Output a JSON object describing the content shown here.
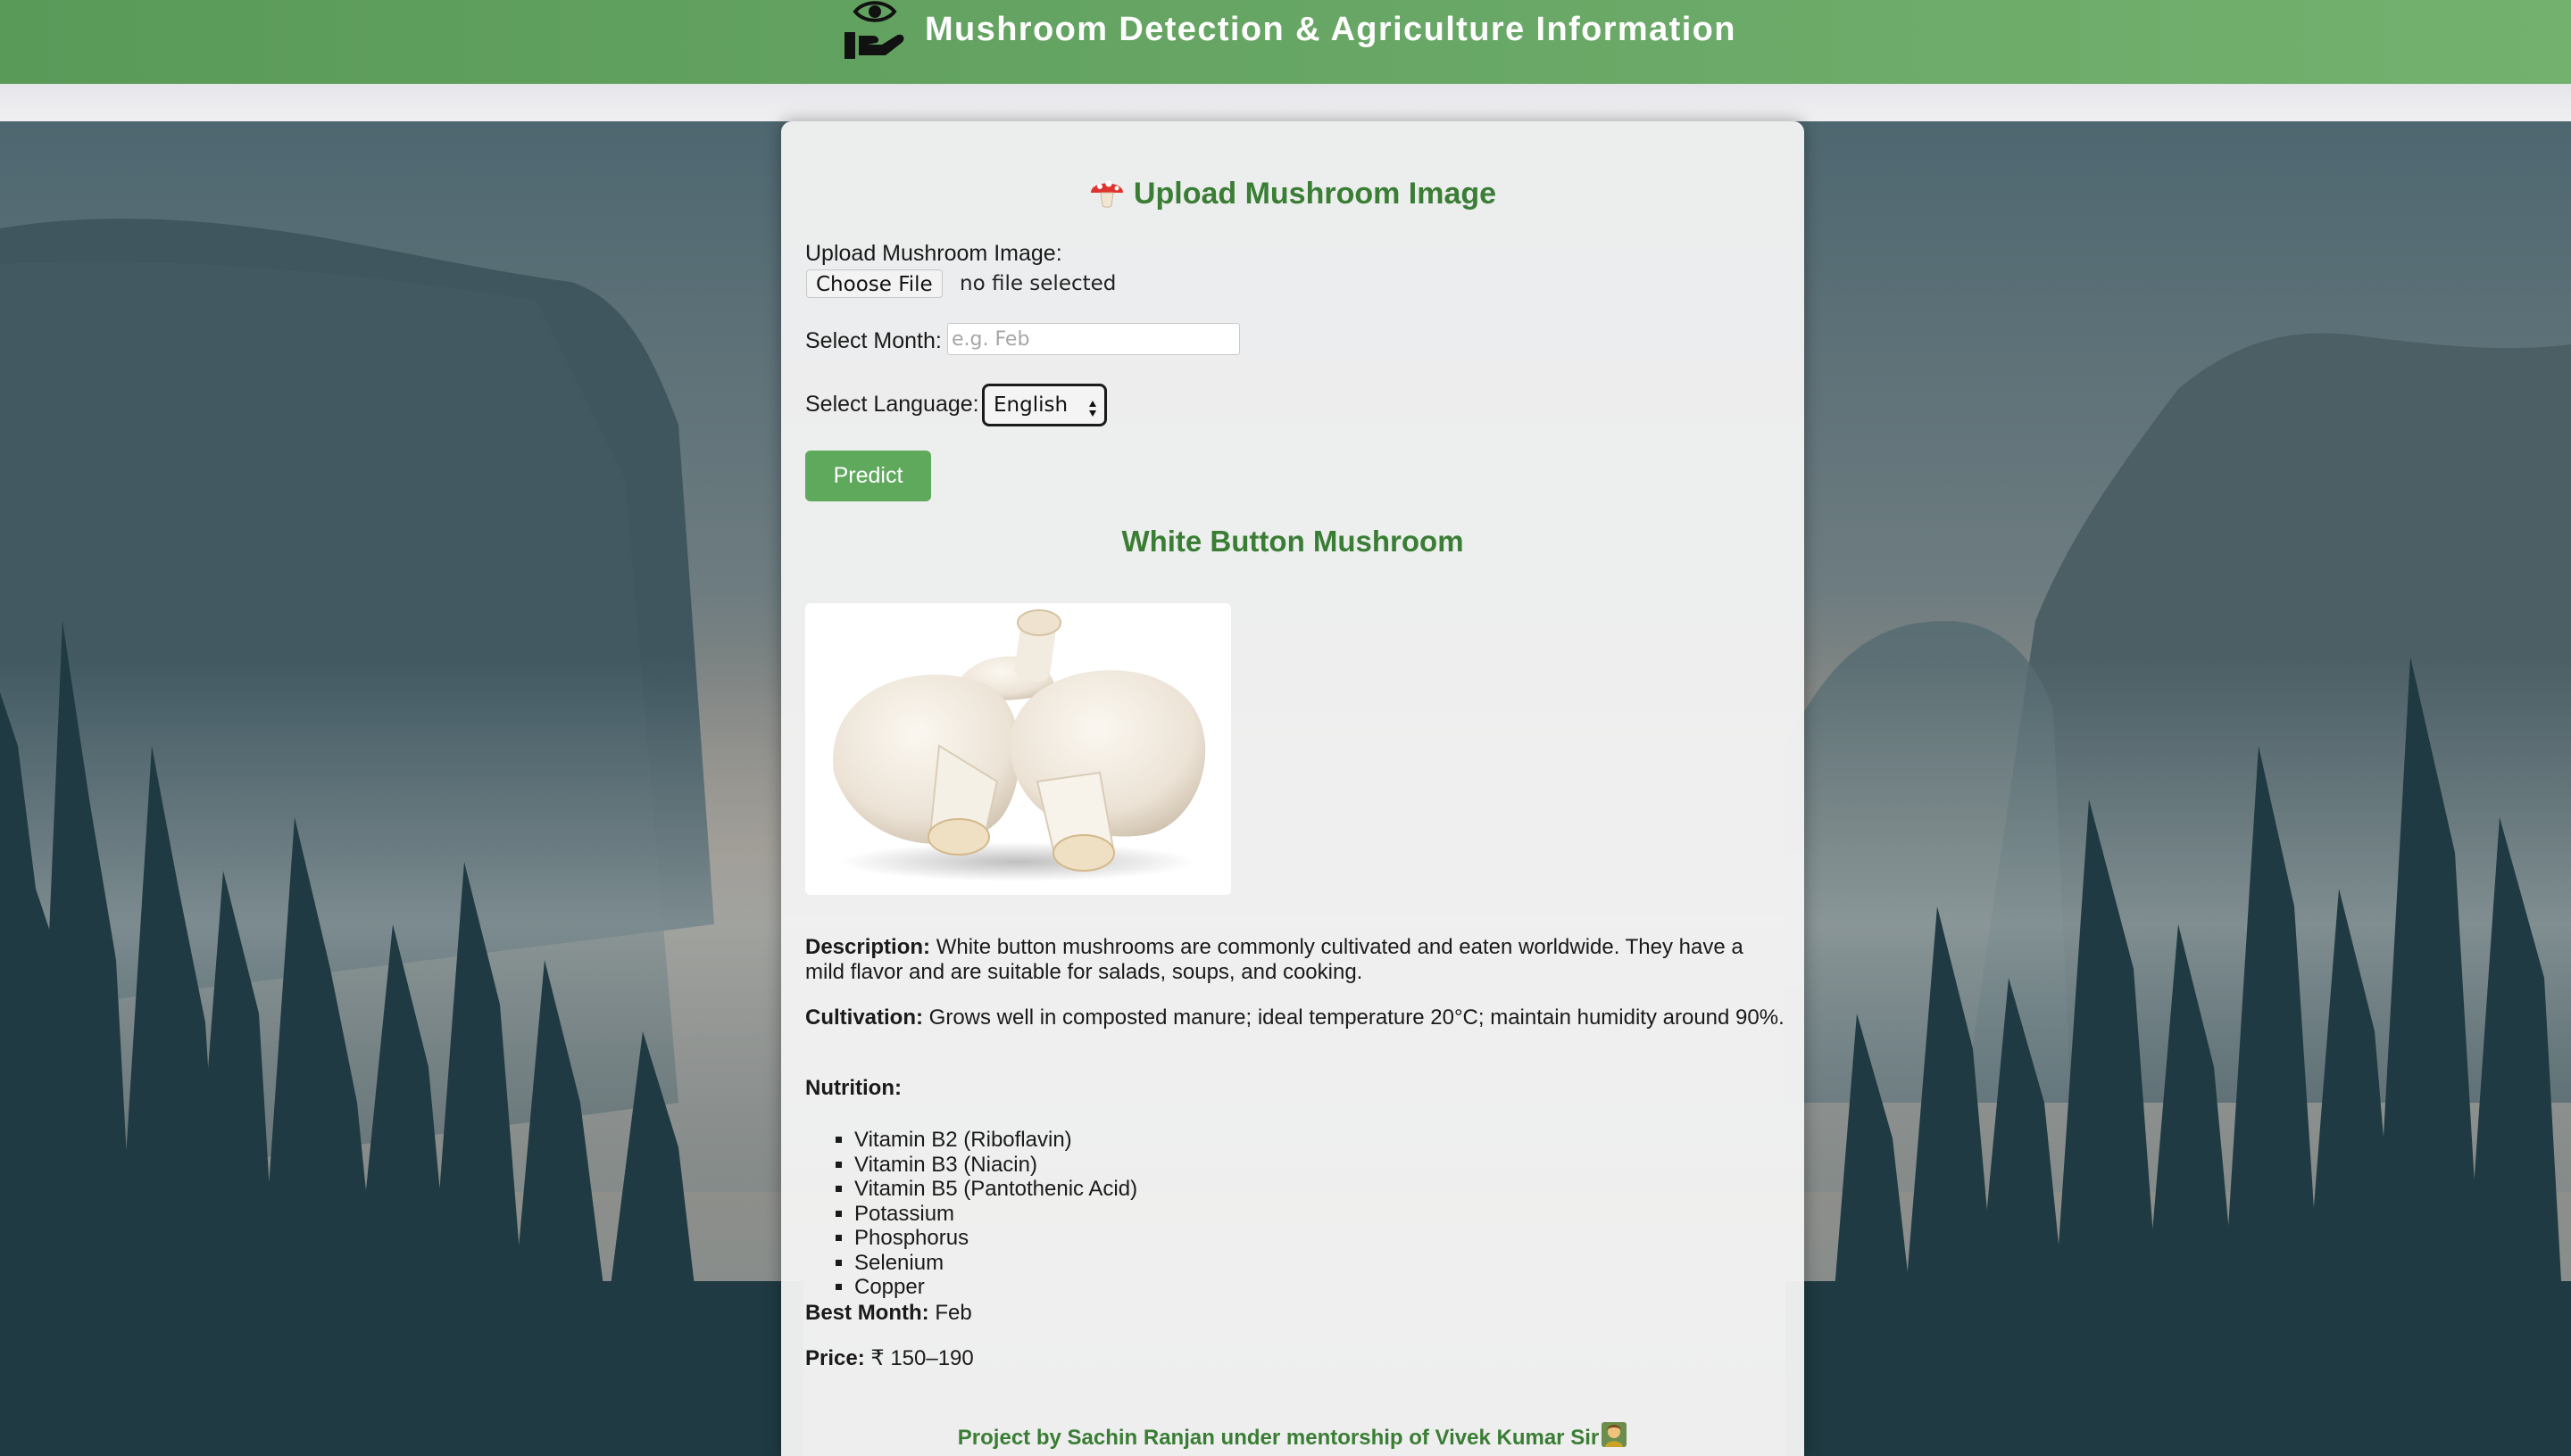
{
  "header": {
    "title": "Mushroom Detection & Agriculture Information",
    "logo_icon": "eye-hand-icon"
  },
  "form": {
    "heading": "Upload Mushroom Image",
    "heading_icon": "mushroom-icon",
    "upload_label": "Upload Mushroom Image:",
    "choose_file_label": "Choose File",
    "file_status": "no file selected",
    "month_label": "Select Month:",
    "month_value": "",
    "month_placeholder": "e.g. Feb",
    "language_label": "Select Language:",
    "language_selected": "English",
    "predict_label": "Predict"
  },
  "result": {
    "name": "White Button Mushroom",
    "image_icon": "white-button-mushroom-photo",
    "description_label": "Description:",
    "description": "White button mushrooms are commonly cultivated and eaten worldwide. They have a mild flavor and are suitable for salads, soups, and cooking.",
    "cultivation_label": "Cultivation:",
    "cultivation": "Grows well in composted manure; ideal temperature 20°C; maintain humidity around 90%.",
    "nutrition_label": "Nutrition:",
    "nutrition": [
      "Vitamin B2 (Riboflavin)",
      "Vitamin B3 (Niacin)",
      "Vitamin B5 (Pantothenic Acid)",
      "Potassium",
      "Phosphorus",
      "Selenium",
      "Copper"
    ],
    "best_month_label": "Best Month:",
    "best_month": "Feb",
    "price_label": "Price:",
    "price": "₹ 150–190"
  },
  "footer": {
    "credit": "Project by Sachin Ranjan under mentorship of Vivek Kumar Sir",
    "credit_icon": "teacher-emoji-icon"
  },
  "colors": {
    "header_green": "#5f9f5d",
    "heading_green": "#3a7d34",
    "button_green": "#5fa95d",
    "card_bg": "#f2f2f2"
  }
}
